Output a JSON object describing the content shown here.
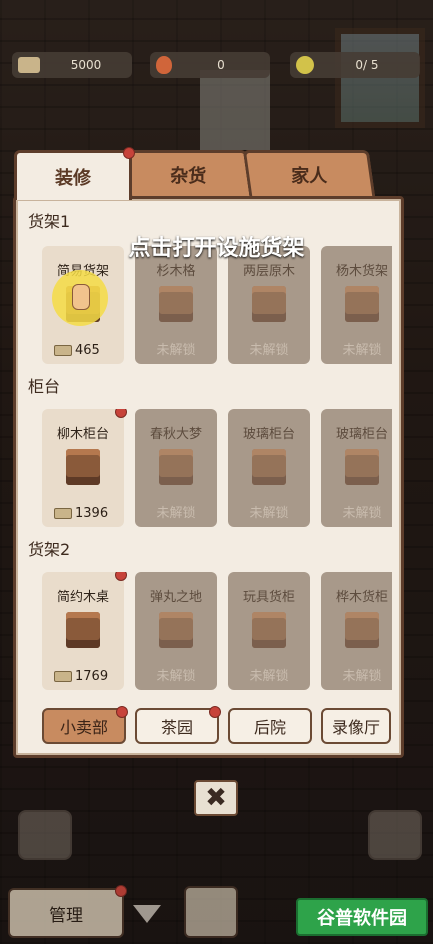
{
  "resources": {
    "money": "5000",
    "fire": "0",
    "star": "0/ 5"
  },
  "tabs": [
    "装修",
    "杂货",
    "家人"
  ],
  "hint": "点击打开设施货架",
  "sections": [
    {
      "title": "货架1",
      "items": [
        {
          "name": "简易货架",
          "price": "465",
          "locked": false
        },
        {
          "name": "杉木格",
          "lock": "未解锁",
          "locked": true
        },
        {
          "name": "两层原木",
          "lock": "未解锁",
          "locked": true
        },
        {
          "name": "杨木货架",
          "lock": "未解锁",
          "locked": true
        }
      ]
    },
    {
      "title": "柜台",
      "items": [
        {
          "name": "柳木柜台",
          "price": "1396",
          "locked": false
        },
        {
          "name": "春秋大梦",
          "lock": "未解锁",
          "locked": true
        },
        {
          "name": "玻璃柜台",
          "lock": "未解锁",
          "locked": true
        },
        {
          "name": "玻璃柜台",
          "lock": "未解锁",
          "locked": true
        }
      ]
    },
    {
      "title": "货架2",
      "items": [
        {
          "name": "简约木桌",
          "price": "1769",
          "locked": false
        },
        {
          "name": "弹丸之地",
          "lock": "未解锁",
          "locked": true
        },
        {
          "name": "玩具货柜",
          "lock": "未解锁",
          "locked": true
        },
        {
          "name": "桦木货柜",
          "lock": "未解锁",
          "locked": true
        }
      ]
    }
  ],
  "categories": [
    "小卖部",
    "茶园",
    "后院",
    "录像厅"
  ],
  "close_label": "✖",
  "manage_label": "管理",
  "watermark": "谷普软件园"
}
